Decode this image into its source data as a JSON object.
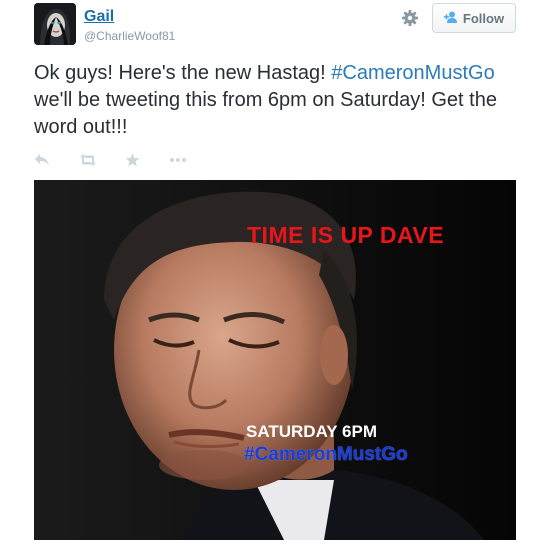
{
  "user": {
    "display_name": "Gail",
    "handle": "@CharlieWoof81",
    "avatar_icon": "profile-photo"
  },
  "header": {
    "settings_icon": "gear-icon",
    "follow_label": "Follow",
    "follow_icon": "add-user-icon"
  },
  "tweet": {
    "text_lead": "Ok guys! Here's the new Hastag! ",
    "hashtag": "#CameronMustGo",
    "text_tail": " we'll be tweeting this from 6pm on Saturday! Get the word out!!!"
  },
  "actions": [
    {
      "name": "reply",
      "icon": "reply-icon"
    },
    {
      "name": "retweet",
      "icon": "retweet-icon"
    },
    {
      "name": "favorite",
      "icon": "star-icon"
    },
    {
      "name": "more",
      "icon": "more-icon"
    }
  ],
  "media": {
    "headline": "TIME IS UP DAVE",
    "date_line": "SATURDAY 6PM",
    "hashtag_line": "#CameronMustGo"
  },
  "colors": {
    "link": "#2b7bb9",
    "name": "#1b6fa8",
    "handle": "#8899a6",
    "headline_red": "#e8161b",
    "hashtag_blue": "#1a3cd8"
  }
}
